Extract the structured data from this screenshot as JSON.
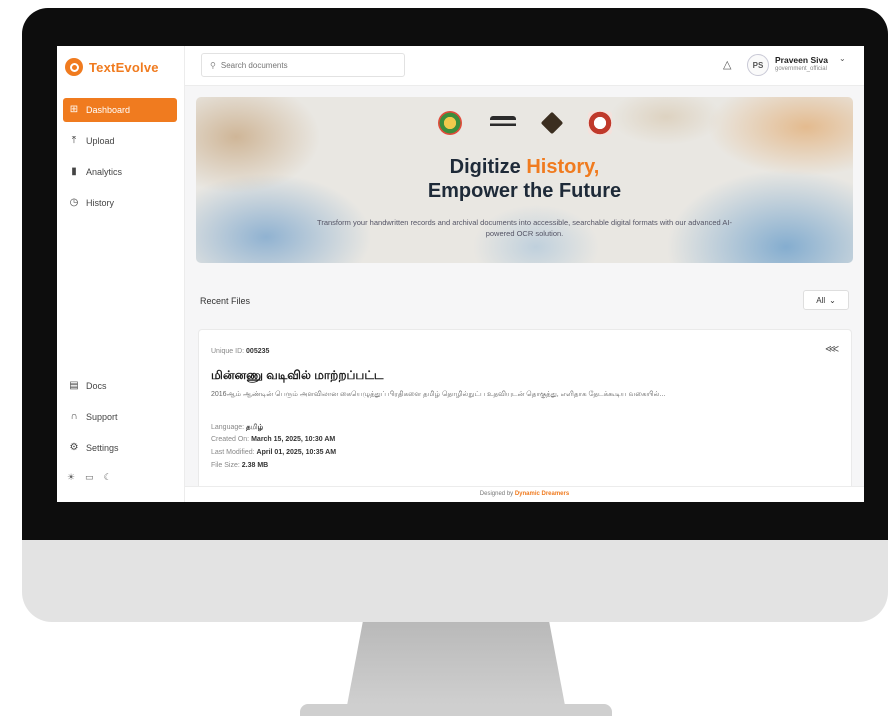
{
  "app": {
    "brand": "TextEvolve"
  },
  "sidebar": {
    "items": [
      {
        "label": "Dashboard",
        "icon": "grid-icon"
      },
      {
        "label": "Upload",
        "icon": "upload-icon"
      },
      {
        "label": "Analytics",
        "icon": "bar-chart-icon"
      },
      {
        "label": "History",
        "icon": "clock-icon"
      }
    ],
    "bottom_items": [
      {
        "label": "Docs",
        "icon": "document-icon"
      },
      {
        "label": "Support",
        "icon": "headset-icon"
      },
      {
        "label": "Settings",
        "icon": "gear-icon"
      }
    ]
  },
  "topbar": {
    "search_placeholder": "Search documents",
    "avatar_initials": "PS",
    "user_name": "Praveen Siva",
    "user_role": "government_official"
  },
  "hero": {
    "title_part1": "Digitize ",
    "title_accent": "History,",
    "title_line2": "Empower the Future",
    "subtitle": "Transform your handwritten records and archival documents into accessible, searchable digital formats with our advanced AI-powered OCR solution."
  },
  "recent": {
    "label": "Recent Files",
    "filter": "All"
  },
  "file": {
    "uid_label": "Unique ID:",
    "uid_value": "005235",
    "title": "மின்னணு வடிவில் மாற்றப்பட்ட",
    "description": "2016ஆம் ஆண்டின் பெரும் அளவிலான கையெழுத்துப் பிரதிகளை தமிழ் தொழில்நுட்ப உதவியுடன் தொகுத்து, எளிதாக தேடக்கூடிய வகையில்...",
    "language_label": "Language:",
    "language_value": "தமிழ்",
    "created_label": "Created On:",
    "created_value": "March 15, 2025, 10:30 AM",
    "modified_label": "Last Modified:",
    "modified_value": "April 01, 2025, 10:35 AM",
    "size_label": "File Size:",
    "size_value": "2.38 MB"
  },
  "footer": {
    "prefix": "Designed by ",
    "brand": "Dynamic Dreamers"
  },
  "colors": {
    "accent": "#f07b1f",
    "title": "#1e2a38"
  }
}
